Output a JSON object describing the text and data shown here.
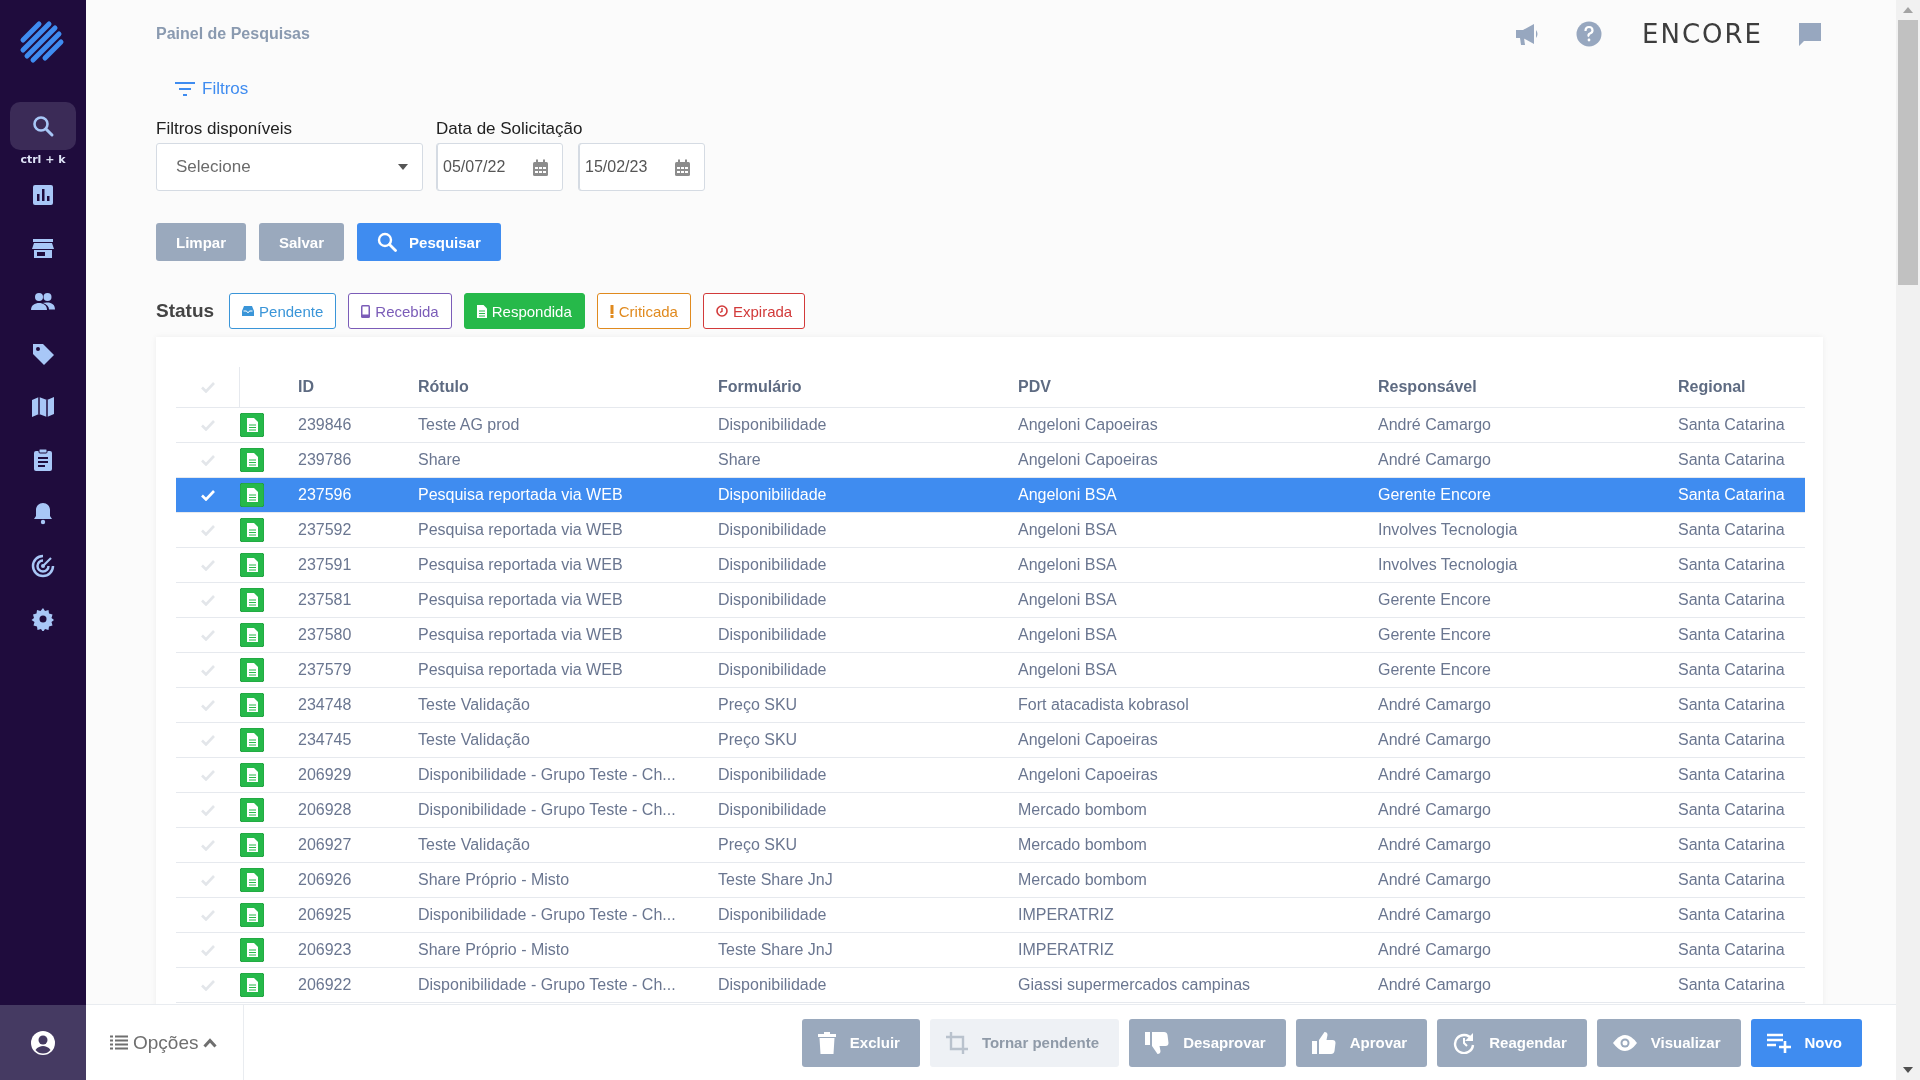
{
  "sidebar": {
    "items": [
      {
        "selected": true,
        "shortcut": "ctrl + k"
      },
      {
        "selected": false
      },
      {
        "selected": false
      },
      {
        "selected": false
      },
      {
        "selected": false
      },
      {
        "selected": false
      },
      {
        "selected": false
      },
      {
        "selected": false
      },
      {
        "selected": false
      },
      {
        "selected": false
      }
    ]
  },
  "header": {
    "breadcrumb": "Painel de Pesquisas",
    "logo": "ENCORE"
  },
  "filters": {
    "toggle": "Filtros",
    "available": {
      "label": "Filtros disponíveis",
      "placeholder": "Selecione"
    },
    "date": {
      "label": "Data de Solicitação",
      "from": "05/07/22",
      "to": "15/02/23"
    },
    "buttons": [
      {
        "label": "Limpar",
        "kind": "secondary"
      },
      {
        "label": "Salvar",
        "kind": "secondary"
      },
      {
        "label": "Pesquisar",
        "kind": "primary"
      }
    ]
  },
  "status": {
    "label": "Status",
    "chips": [
      {
        "label": "Pendente",
        "kind": "inbox",
        "color": "#3a95d8",
        "selected": false
      },
      {
        "label": "Recebida",
        "kind": "phone",
        "color": "#7b5cb8",
        "selected": false
      },
      {
        "label": "Respondida",
        "kind": "document",
        "color": "#26b94a",
        "selected": true
      },
      {
        "label": "Criticada",
        "kind": "exclamation",
        "color": "#e08a1e",
        "selected": false
      },
      {
        "label": "Expirada",
        "kind": "clock",
        "color": "#d23a3a",
        "selected": false
      }
    ]
  },
  "table": {
    "select_all": {
      "checked": false
    },
    "columns": [
      "ID",
      "Rótulo",
      "Formulário",
      "PDV",
      "Responsável",
      "Regional"
    ],
    "rows": [
      {
        "selected": false,
        "cells": [
          "239846",
          "Teste AG prod",
          "Disponibilidade",
          "Angeloni Capoeiras",
          "André Camargo",
          "Santa Catarina"
        ]
      },
      {
        "selected": false,
        "cells": [
          "239786",
          "Share",
          "Share",
          "Angeloni Capoeiras",
          "André Camargo",
          "Santa Catarina"
        ]
      },
      {
        "selected": true,
        "cells": [
          "237596",
          "Pesquisa reportada via WEB",
          "Disponibilidade",
          "Angeloni BSA",
          "Gerente Encore",
          "Santa Catarina"
        ]
      },
      {
        "selected": false,
        "cells": [
          "237592",
          "Pesquisa reportada via WEB",
          "Disponibilidade",
          "Angeloni BSA",
          "Involves Tecnologia",
          "Santa Catarina"
        ]
      },
      {
        "selected": false,
        "cells": [
          "237591",
          "Pesquisa reportada via WEB",
          "Disponibilidade",
          "Angeloni BSA",
          "Involves Tecnologia",
          "Santa Catarina"
        ]
      },
      {
        "selected": false,
        "cells": [
          "237581",
          "Pesquisa reportada via WEB",
          "Disponibilidade",
          "Angeloni BSA",
          "Gerente Encore",
          "Santa Catarina"
        ]
      },
      {
        "selected": false,
        "cells": [
          "237580",
          "Pesquisa reportada via WEB",
          "Disponibilidade",
          "Angeloni BSA",
          "Gerente Encore",
          "Santa Catarina"
        ]
      },
      {
        "selected": false,
        "cells": [
          "237579",
          "Pesquisa reportada via WEB",
          "Disponibilidade",
          "Angeloni BSA",
          "Gerente Encore",
          "Santa Catarina"
        ]
      },
      {
        "selected": false,
        "cells": [
          "234748",
          "Teste Validação",
          "Preço SKU",
          "Fort atacadista kobrasol",
          "André Camargo",
          "Santa Catarina"
        ]
      },
      {
        "selected": false,
        "cells": [
          "234745",
          "Teste Validação",
          "Preço SKU",
          "Angeloni Capoeiras",
          "André Camargo",
          "Santa Catarina"
        ]
      },
      {
        "selected": false,
        "cells": [
          "206929",
          "Disponibilidade - Grupo Teste - Ch...",
          "Disponibilidade",
          "Angeloni Capoeiras",
          "André Camargo",
          "Santa Catarina"
        ]
      },
      {
        "selected": false,
        "cells": [
          "206928",
          "Disponibilidade - Grupo Teste - Ch...",
          "Disponibilidade",
          "Mercado bombom",
          "André Camargo",
          "Santa Catarina"
        ]
      },
      {
        "selected": false,
        "cells": [
          "206927",
          "Teste Validação",
          "Preço SKU",
          "Mercado bombom",
          "André Camargo",
          "Santa Catarina"
        ]
      },
      {
        "selected": false,
        "cells": [
          "206926",
          "Share Próprio - Misto",
          "Teste Share JnJ",
          "Mercado bombom",
          "André Camargo",
          "Santa Catarina"
        ]
      },
      {
        "selected": false,
        "cells": [
          "206925",
          "Disponibilidade - Grupo Teste - Ch...",
          "Disponibilidade",
          "IMPERATRIZ",
          "André Camargo",
          "Santa Catarina"
        ]
      },
      {
        "selected": false,
        "cells": [
          "206923",
          "Share Próprio - Misto",
          "Teste Share JnJ",
          "IMPERATRIZ",
          "André Camargo",
          "Santa Catarina"
        ]
      },
      {
        "selected": false,
        "cells": [
          "206922",
          "Disponibilidade - Grupo Teste - Ch...",
          "Disponibilidade",
          "Giassi supermercados campinas",
          "André Camargo",
          "Santa Catarina"
        ]
      }
    ]
  },
  "options": {
    "label": "Opções",
    "expanded": true
  },
  "actions": [
    {
      "label": "Excluir",
      "kind": "trash",
      "disabled": false
    },
    {
      "label": "Tornar pendente",
      "kind": "crop",
      "disabled": true
    },
    {
      "label": "Desaprovar",
      "kind": "thumbs-down",
      "disabled": false
    },
    {
      "label": "Aprovar",
      "kind": "thumbs-up",
      "disabled": false
    },
    {
      "label": "Reagendar",
      "kind": "redo",
      "disabled": false
    },
    {
      "label": "Visualizar",
      "kind": "eye",
      "disabled": false
    },
    {
      "label": "Novo",
      "kind": "list-add",
      "disabled": false
    }
  ]
}
